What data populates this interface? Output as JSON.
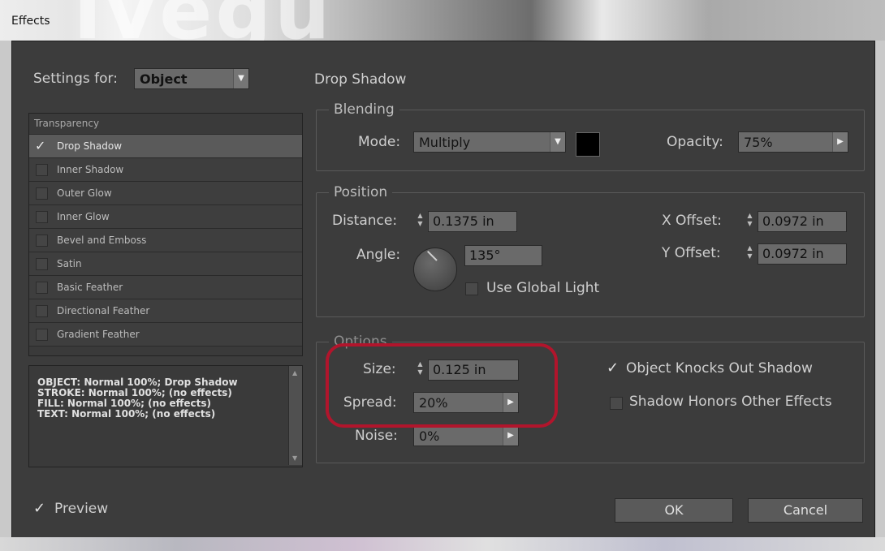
{
  "window": {
    "title": "Effects"
  },
  "settings_for": {
    "label": "Settings for:",
    "value": "Object"
  },
  "panel_title": "Drop Shadow",
  "effects_list": {
    "header": "Transparency",
    "items": [
      {
        "label": "Drop Shadow",
        "checked": true,
        "selected": true
      },
      {
        "label": "Inner Shadow",
        "checked": false
      },
      {
        "label": "Outer Glow",
        "checked": false
      },
      {
        "label": "Inner Glow",
        "checked": false
      },
      {
        "label": "Bevel and Emboss",
        "checked": false
      },
      {
        "label": "Satin",
        "checked": false
      },
      {
        "label": "Basic Feather",
        "checked": false
      },
      {
        "label": "Directional Feather",
        "checked": false
      },
      {
        "label": "Gradient Feather",
        "checked": false
      }
    ]
  },
  "summary_lines": [
    "OBJECT: Normal 100%; Drop Shadow",
    "STROKE: Normal 100%; (no effects)",
    "FILL: Normal 100%; (no effects)",
    "TEXT: Normal 100%; (no effects)"
  ],
  "blending": {
    "title": "Blending",
    "mode_label": "Mode:",
    "mode_value": "Multiply",
    "color": "#000000",
    "opacity_label": "Opacity:",
    "opacity_value": "75%"
  },
  "position": {
    "title": "Position",
    "distance_label": "Distance:",
    "distance_value": "0.1375 in",
    "angle_label": "Angle:",
    "angle_value": "135°",
    "use_global_light_label": "Use Global Light",
    "x_offset_label": "X Offset:",
    "x_offset_value": "0.0972 in",
    "y_offset_label": "Y Offset:",
    "y_offset_value": "0.0972 in"
  },
  "options": {
    "title": "Options",
    "size_label": "Size:",
    "size_value": "0.125 in",
    "spread_label": "Spread:",
    "spread_value": "20%",
    "noise_label": "Noise:",
    "noise_value": "0%",
    "knocks_out_label": "Object Knocks Out Shadow",
    "knocks_out_checked": true,
    "honors_effects_label": "Shadow Honors Other Effects",
    "honors_effects_checked": false
  },
  "preview": {
    "label": "Preview",
    "checked": true
  },
  "buttons": {
    "ok": "OK",
    "cancel": "Cancel"
  },
  "highlight_color": "#b1152c"
}
